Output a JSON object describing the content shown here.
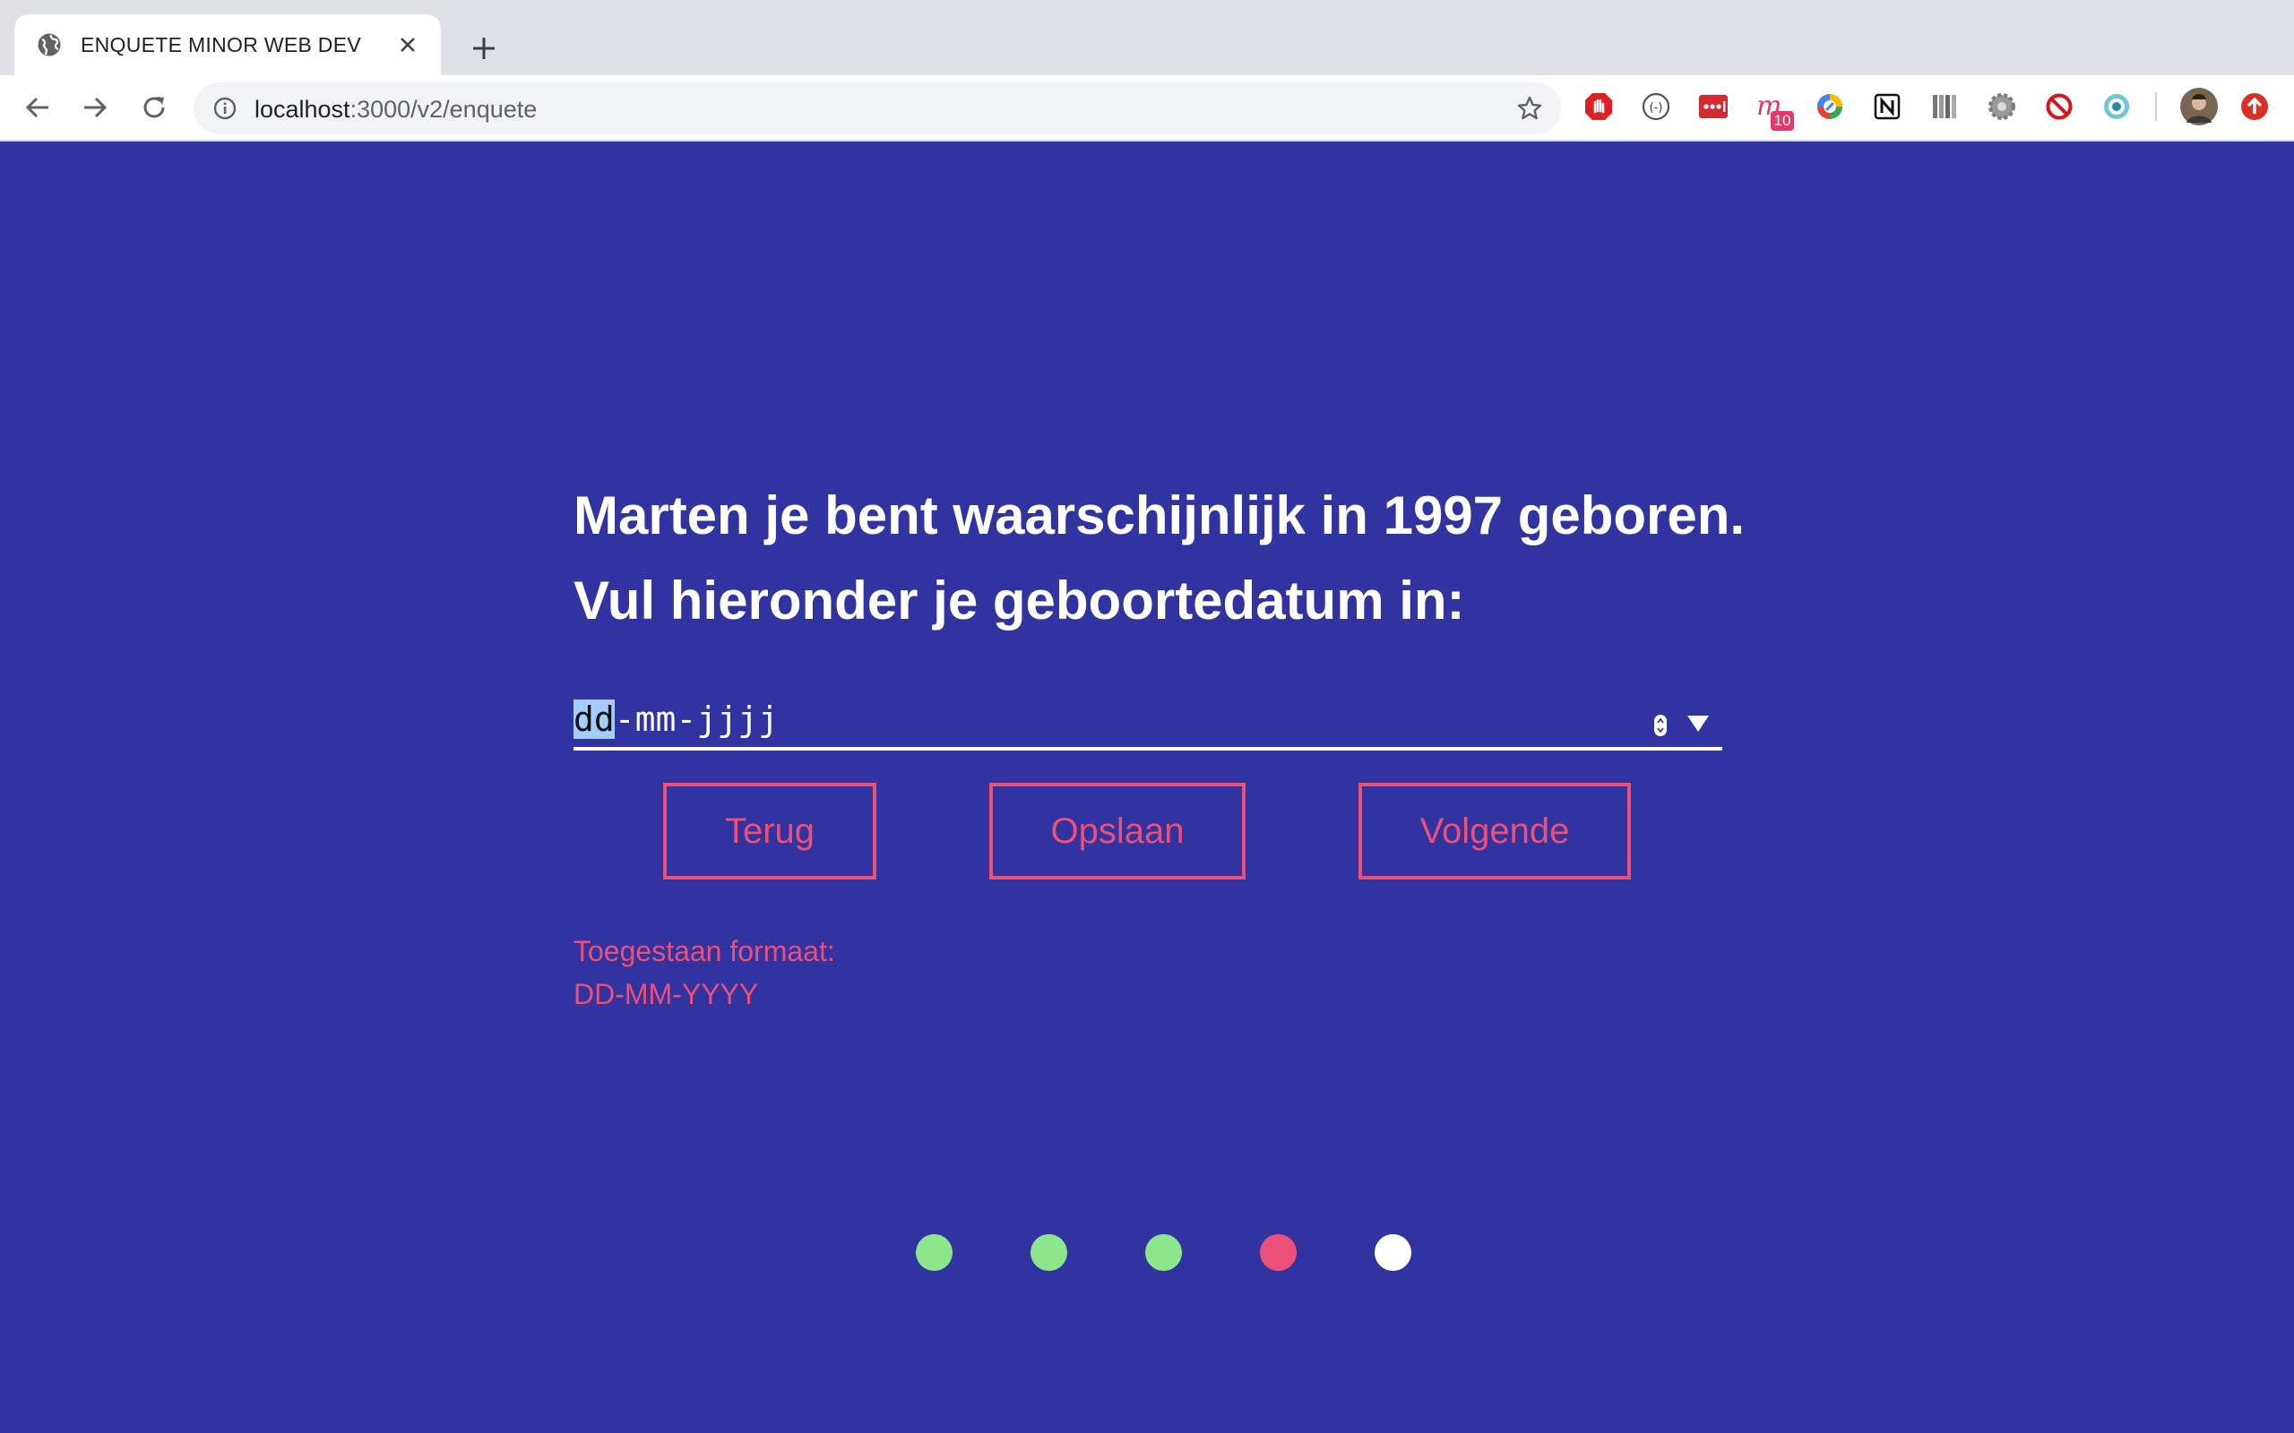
{
  "browser": {
    "tab": {
      "title": "ENQUETE MINOR WEB DEV",
      "favicon": "globe-icon"
    },
    "url": {
      "host": "localhost",
      "path": ":3000/v2/enquete"
    },
    "extensions": [
      {
        "name": "adblock-icon"
      },
      {
        "name": "lingo-icon"
      },
      {
        "name": "lastpass-icon"
      },
      {
        "name": "mindful-icon",
        "badge": "10"
      },
      {
        "name": "chrome-remote-icon"
      },
      {
        "name": "notion-icon"
      },
      {
        "name": "library-icon"
      },
      {
        "name": "settings-extension-icon"
      },
      {
        "name": "block-icon"
      },
      {
        "name": "eye-icon"
      },
      {
        "name": "profile-avatar"
      },
      {
        "name": "update-icon"
      }
    ]
  },
  "page": {
    "heading": {
      "line1": "Marten je bent waarschijnlijk in 1997 geboren.",
      "line2": "Vul hieronder je geboortedatum in:"
    },
    "date_input": {
      "segment_day": "dd",
      "separator1": "-",
      "segment_month": "mm",
      "separator2": "-",
      "segment_year": "jjjj"
    },
    "buttons": {
      "back": "Terug",
      "save": "Opslaan",
      "next": "Volgende"
    },
    "format_hint": {
      "label": "Toegestaan formaat:",
      "format": "DD-MM-YYYY"
    },
    "progress": {
      "current_step": 4,
      "total_steps": 5,
      "steps": [
        "completed",
        "completed",
        "completed",
        "current",
        "pending"
      ]
    },
    "colors": {
      "background": "#3033a0",
      "accent": "#ec4f77",
      "completed": "#8ee68c",
      "pending": "#ffffff"
    }
  }
}
